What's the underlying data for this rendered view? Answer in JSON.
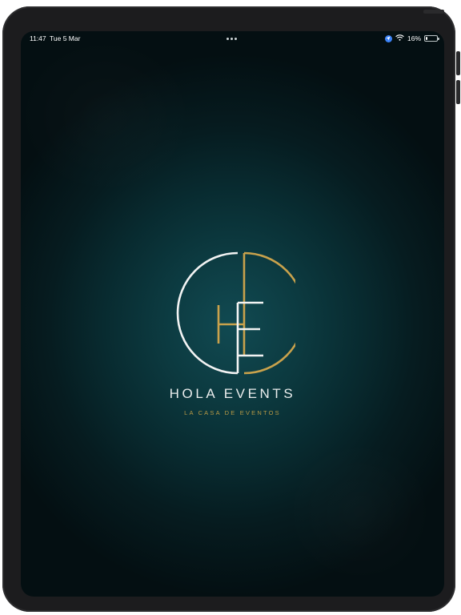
{
  "status_bar": {
    "time": "11:47",
    "date": "Tue 5 Mar",
    "battery_percent": "16%",
    "battery_level": 0.16,
    "icons": [
      "location-icon",
      "wifi-icon",
      "battery-icon"
    ]
  },
  "splash": {
    "logo_letters": "HE",
    "title": "HOLA EVENTS",
    "tagline": "LA CASA DE EVENTOS"
  },
  "colors": {
    "background_center": "#114a52",
    "background_edge": "#040f12",
    "logo_white": "#f2f3f3",
    "logo_gold": "#c9a24c",
    "title_text": "#e9ecec",
    "tagline_text": "#b99a45",
    "device_frame": "#1c1c1e"
  }
}
